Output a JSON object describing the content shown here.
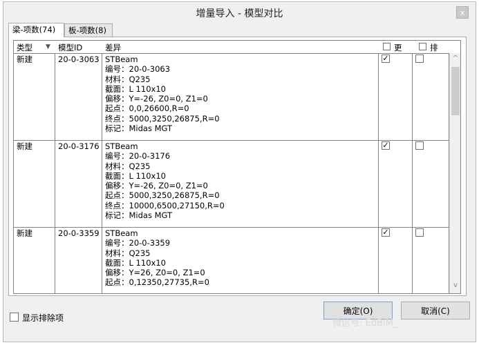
{
  "window": {
    "title": "增量导入 - 模型对比",
    "close_glyph": "x"
  },
  "tabs": [
    {
      "label": "梁-项数(74)"
    },
    {
      "label": "板-项数(8)"
    }
  ],
  "columns": {
    "type": "类型",
    "sort_glyph": "▼",
    "model_id": "模型ID",
    "diff": "差异",
    "update": "更",
    "exclude": "排"
  },
  "rows": [
    {
      "type": "新建",
      "model_id": "20-0-3063",
      "diff_lines": [
        "STBeam",
        "编号：20-0-3063",
        "材料：Q235",
        "截面：L 110x10",
        "偏移：Y=-26, Z0=0, Z1=0",
        "起点：0,0,26600,R=0",
        "终点：5000,3250,26875,R=0",
        "标记：Midas MGT"
      ],
      "update_checked": true,
      "exclude_checked": false
    },
    {
      "type": "新建",
      "model_id": "20-0-3176",
      "diff_lines": [
        "STBeam",
        "编号：20-0-3176",
        "材料：Q235",
        "截面：L 110x10",
        "偏移：Y=-26, Z0=0, Z1=0",
        "起点：5000,3250,26875,R=0",
        "终点：10000,6500,27150,R=0",
        "标记：Midas MGT"
      ],
      "update_checked": true,
      "exclude_checked": false
    },
    {
      "type": "新建",
      "model_id": "20-0-3359",
      "diff_lines": [
        "STBeam",
        "编号：20-0-3359",
        "材料：Q235",
        "截面：L 110x10",
        "偏移：Y=26, Z0=0, Z1=0",
        "起点：0,12350,27735,R=0"
      ],
      "update_checked": true,
      "exclude_checked": false
    }
  ],
  "check_glyph": "✓",
  "scroll_up_glyph": "^",
  "scroll_down_glyph": "v",
  "footer": {
    "show_excluded_label": "显示排除项",
    "ok_label": "确定(O)",
    "cancel_label": "取消(C)",
    "watermark": "微信号: EdBIM_"
  }
}
